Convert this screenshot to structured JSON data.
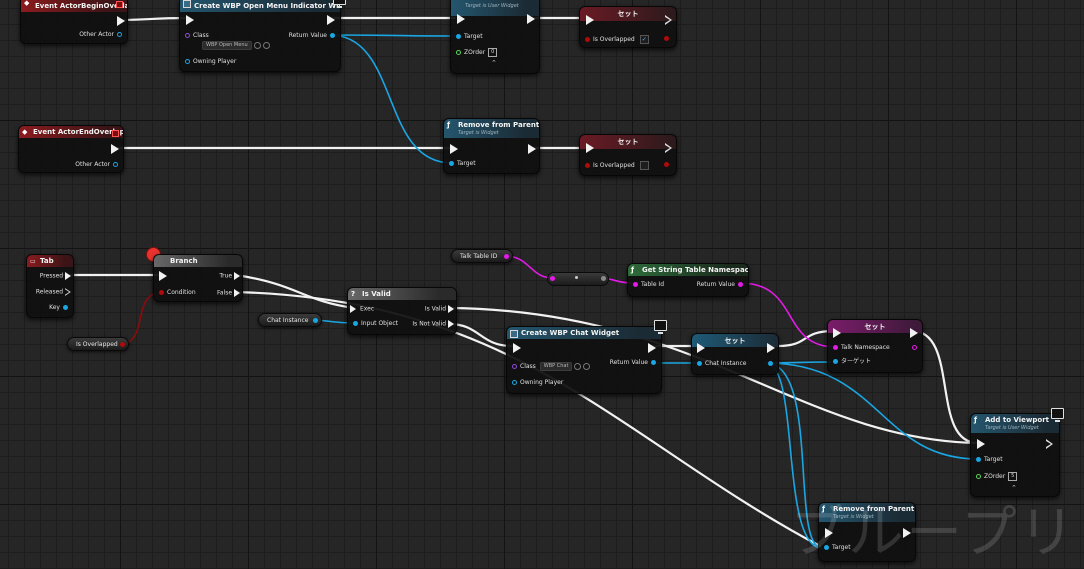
{
  "event_begin_overlap": {
    "title": "Event ActorBeginOverlap",
    "pin_other_actor": "Other Actor"
  },
  "event_end_overlap": {
    "title": "Event ActorEndOverlap",
    "pin_other_actor": "Other Actor"
  },
  "create_open_menu": {
    "title": "Create WBP Open Menu Indicator Widget",
    "pin_class": "Class",
    "class_value": "WBP Open Menu",
    "pin_return": "Return Value",
    "pin_owner": "Owning Player"
  },
  "add_to_viewport_top": {
    "subtitle": "Target is User Widget",
    "pin_target": "Target",
    "pin_zorder": "ZOrder",
    "zorder_value": "0"
  },
  "set_overlapped_1": {
    "title": "セット",
    "pin": "Is Overlapped",
    "checked": "✓"
  },
  "remove_parent_top": {
    "title": "Remove from Parent",
    "subtitle": "Target is Widget",
    "pin_target": "Target"
  },
  "set_overlapped_2": {
    "title": "セット",
    "pin": "Is Overlapped"
  },
  "tab_event": {
    "title": "Tab",
    "pin_pressed": "Pressed",
    "pin_released": "Released",
    "pin_key": "Key"
  },
  "branch": {
    "title": "Branch",
    "pin_true": "True",
    "pin_false": "False",
    "pin_condition": "Condition"
  },
  "is_overlapped_var": {
    "label": "Is Overlapped"
  },
  "is_valid": {
    "title": "Is Valid",
    "pin_exec": "Exec",
    "pin_input": "Input Object",
    "pin_valid": "Is Valid",
    "pin_not_valid": "Is Not Valid"
  },
  "chat_instance_var": {
    "label": "Chat Instance"
  },
  "talk_table_var": {
    "label": "Talk Table ID"
  },
  "get_string_table": {
    "title": "Get String Table Namespace",
    "pin_table": "Table Id",
    "pin_return": "Return Value"
  },
  "create_chat": {
    "title": "Create WBP Chat Widget",
    "pin_class": "Class",
    "class_value": "WBP Chat",
    "pin_return": "Return Value",
    "pin_owner": "Owning Player"
  },
  "set_chat_instance": {
    "title": "セット",
    "pin": "Chat Instance"
  },
  "set_talk_namespace": {
    "title": "セット",
    "pin_ns": "Talk Namespace",
    "pin_target": "ターゲット"
  },
  "add_to_viewport": {
    "title": "Add to Viewport",
    "subtitle": "Target is User Widget",
    "pin_target": "Target",
    "pin_zorder": "ZOrder",
    "zorder_value": "5"
  },
  "remove_parent_bottom": {
    "title": "Remove from Parent",
    "subtitle": "Target is Widget",
    "pin_target": "Target"
  },
  "watermark": {
    "text": "ブループリ"
  },
  "colors": {
    "exec": "#f2f2f2",
    "object": "#1aa6e2",
    "text": "#e21be7",
    "bool": "#b00a0a",
    "event_header": "#8b1b1f",
    "function_header": "#24566e"
  }
}
